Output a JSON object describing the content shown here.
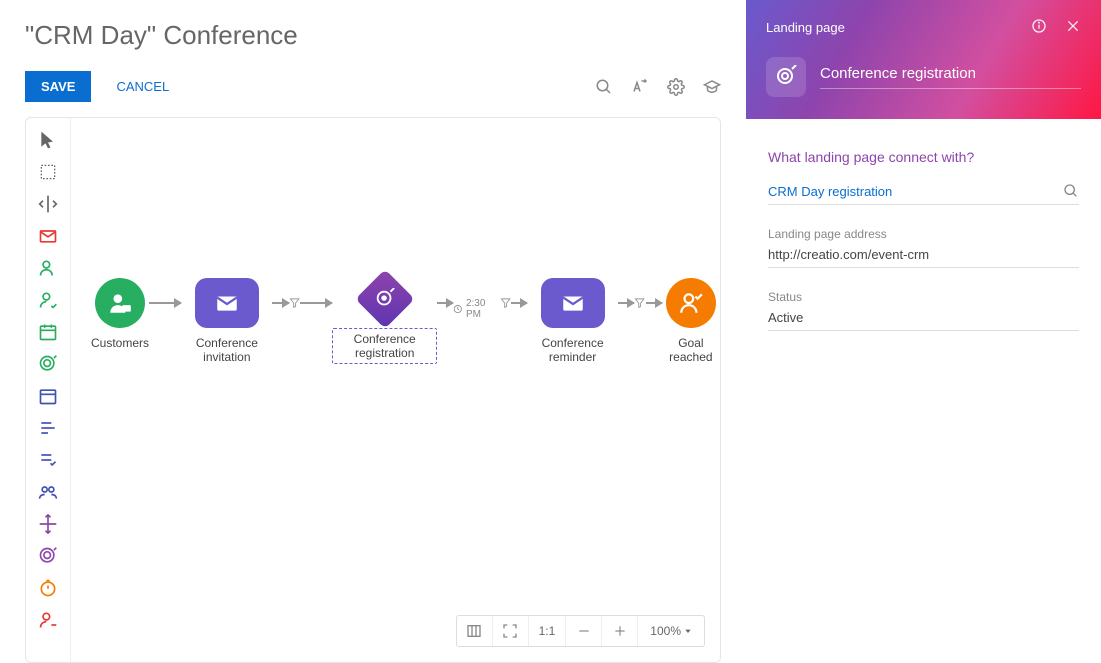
{
  "header": {
    "title": "\"CRM Day\" Conference",
    "save_label": "SAVE",
    "cancel_label": "CANCEL"
  },
  "flow_nodes": {
    "customers": "Customers",
    "conference_invitation": "Conference invitation",
    "conference_registration": "Conference registration",
    "conference_reminder": "Conference reminder",
    "goal_reached": "Goal reached",
    "time_badge": "2:30 PM"
  },
  "zoom": {
    "ratio": "1:1",
    "value": "100%"
  },
  "panel": {
    "type": "Landing page",
    "entity_title": "Conference registration",
    "question": "What landing page connect with?",
    "connect_value": "CRM Day registration",
    "address_label": "Landing page address",
    "address_value": "http://creatio.com/event-crm",
    "status_label": "Status",
    "status_value": "Active"
  }
}
